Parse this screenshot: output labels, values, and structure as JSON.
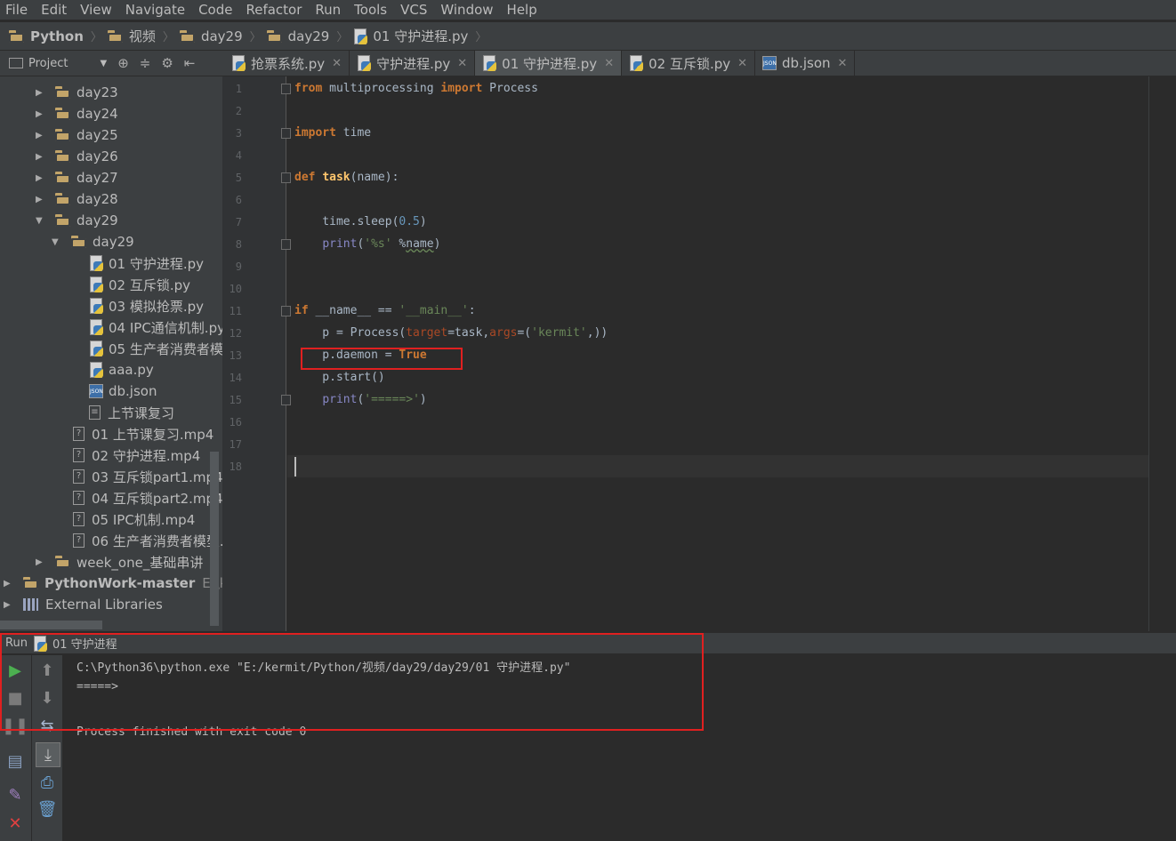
{
  "menu": [
    "File",
    "Edit",
    "View",
    "Navigate",
    "Code",
    "Refactor",
    "Run",
    "Tools",
    "VCS",
    "Window",
    "Help"
  ],
  "breadcrumbs": [
    "Python",
    "视频",
    "day29",
    "day29",
    "01 守护进程.py"
  ],
  "project_tool": {
    "label": "Project"
  },
  "tabs": [
    {
      "label": "抢票系统.py",
      "icon": "python-file-icon"
    },
    {
      "label": "守护进程.py",
      "icon": "python-file-icon"
    },
    {
      "label": "01 守护进程.py",
      "icon": "python-file-icon",
      "active": true
    },
    {
      "label": "02 互斥锁.py",
      "icon": "python-file-icon"
    },
    {
      "label": "db.json",
      "icon": "json-file-icon"
    }
  ],
  "tree": {
    "folders_top": [
      "day23",
      "day24",
      "day25",
      "day26",
      "day27",
      "day28"
    ],
    "day29_outer": "day29",
    "day29_inner": "day29",
    "inner_files": [
      "01 守护进程.py",
      "02 互斥锁.py",
      "03 模拟抢票.py",
      "04 IPC通信机制.py",
      "05 生产者消费者模",
      "aaa.py",
      "db.json",
      "上节课复习"
    ],
    "videos": [
      "01 上节课复习.mp4",
      "02 守护进程.mp4",
      "03 互斥锁part1.mp4",
      "04 互斥锁part2.mp4",
      "05 IPC机制.mp4",
      "06 生产者消费者模型."
    ],
    "week_one": "week_one_基础串讲",
    "pythonwork": "PythonWork-master",
    "pythonwork_path": "E:\\ker",
    "external_libs": "External Libraries"
  },
  "code": {
    "line_numbers": [
      "1",
      "2",
      "3",
      "4",
      "5",
      "6",
      "7",
      "8",
      "9",
      "10",
      "11",
      "12",
      "13",
      "14",
      "15",
      "16",
      "17",
      "18"
    ],
    "l1_from": "from",
    "l1_mod": " multiprocessing ",
    "l1_import": "import",
    "l1_name": " Process",
    "l3_import": "import",
    "l3_mod": " time",
    "l5_def": "def",
    "l5_fn": "task",
    "l5_args": "(name):",
    "l7_a": "    time.sleep(",
    "l7_num": "0.5",
    "l7_b": ")",
    "l8_print": "print",
    "l8_a": "(",
    "l8_str": "'%s'",
    "l8_b": " %",
    "l8_name": "name",
    "l8_c": ")",
    "l11_if": "if",
    "l11_a": " __name__ == ",
    "l11_str": "'__main__'",
    "l11_b": ":",
    "l12_a": "    p = Process(",
    "l12_target": "target",
    "l12_b": "=task,",
    "l12_args": "args",
    "l12_c": "=(",
    "l12_str": "'kermit'",
    "l12_d": ",))",
    "l13_a": "    p.daemon = ",
    "l13_true": "True",
    "l14": "    p.start()",
    "l15_print": "print",
    "l15_a": "(",
    "l15_str": "'=====>'",
    "l15_b": ")"
  },
  "run": {
    "label": "Run",
    "config": "01 守护进程",
    "console": [
      "C:\\Python36\\python.exe \"E:/kermit/Python/视频/day29/day29/01 守护进程.py\"",
      "=====>",
      "",
      "Process finished with exit code 0"
    ]
  },
  "colors": {
    "highlight_box": "#e02020",
    "keyword": "#cc7832",
    "string": "#6a8759",
    "run_green": "#4caf50"
  }
}
